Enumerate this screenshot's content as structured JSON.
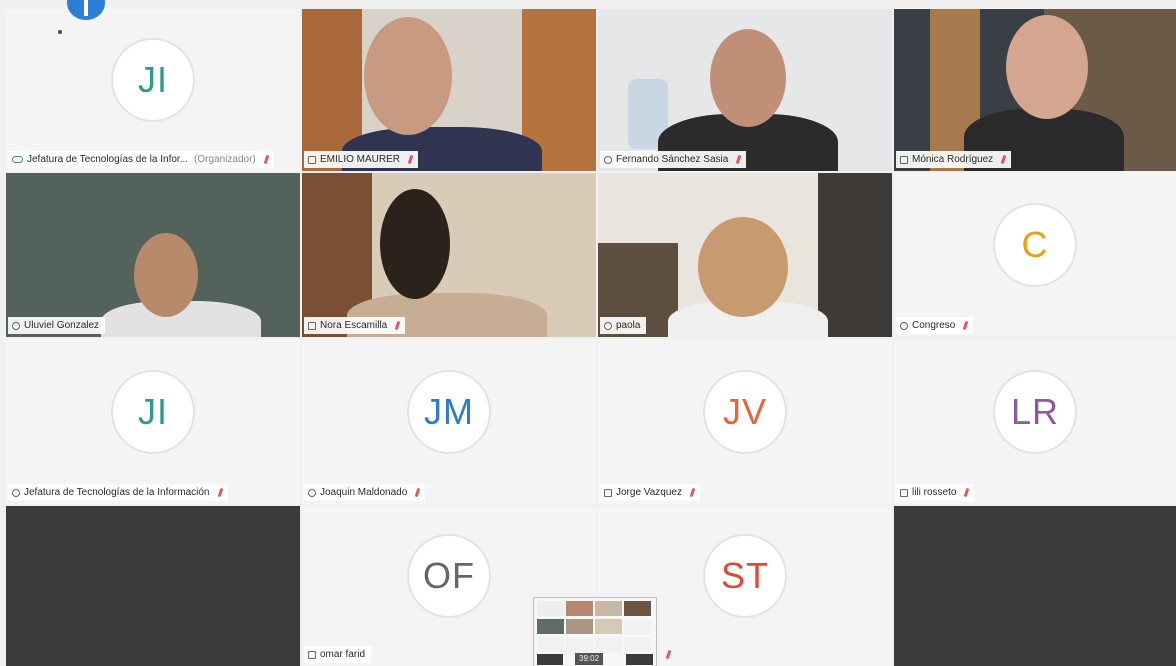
{
  "tiles": [
    {
      "kind": "avatar",
      "initials": "JI",
      "color": "#2a9d8f",
      "name": "Jefatura de Tecnologías de la Infor...",
      "role": "(Organizador)",
      "icon": "cloud-icon"
    },
    {
      "kind": "video",
      "name": "EMILIO MAURER",
      "icon": "square-icon"
    },
    {
      "kind": "video",
      "name": "Fernando Sánchez Sasia",
      "icon": "circle-icon"
    },
    {
      "kind": "video",
      "name": "Mónica Rodríguez",
      "icon": "square-icon"
    },
    {
      "kind": "video",
      "name": "Uluviel Gonzalez",
      "icon": "circle-icon"
    },
    {
      "kind": "video",
      "name": "Nora Escamilla",
      "icon": "square-icon"
    },
    {
      "kind": "video",
      "name": "paola",
      "icon": "circle-icon"
    },
    {
      "kind": "avatar",
      "initials": "C",
      "color": "#e6a117",
      "name": "Congreso",
      "icon": "circle-icon"
    },
    {
      "kind": "avatar",
      "initials": "JI",
      "color": "#2a9d8f",
      "name": "Jefatura de Tecnologías de la Información",
      "icon": "circle-icon"
    },
    {
      "kind": "avatar",
      "initials": "JM",
      "color": "#2b7fc2",
      "name": "Joaquin Maldonado",
      "icon": "circle-icon"
    },
    {
      "kind": "avatar",
      "initials": "JV",
      "color": "#e8643a",
      "name": "Jorge Vazquez",
      "icon": "square-icon"
    },
    {
      "kind": "avatar",
      "initials": "LR",
      "color": "#8d5aa0",
      "name": "lili rosseto",
      "icon": "square-icon"
    },
    {
      "kind": "empty"
    },
    {
      "kind": "avatar",
      "initials": "OF",
      "color": "#666666",
      "name": "omar farid",
      "icon": "square-icon"
    },
    {
      "kind": "avatar",
      "initials": "ST",
      "color": "#e0483c",
      "name": "",
      "icon": ""
    },
    {
      "kind": "empty"
    }
  ],
  "preview": {
    "time": "39:02"
  },
  "colors": {
    "mic_muted": "#e05a5a",
    "app_accent": "#2d7fd6"
  }
}
